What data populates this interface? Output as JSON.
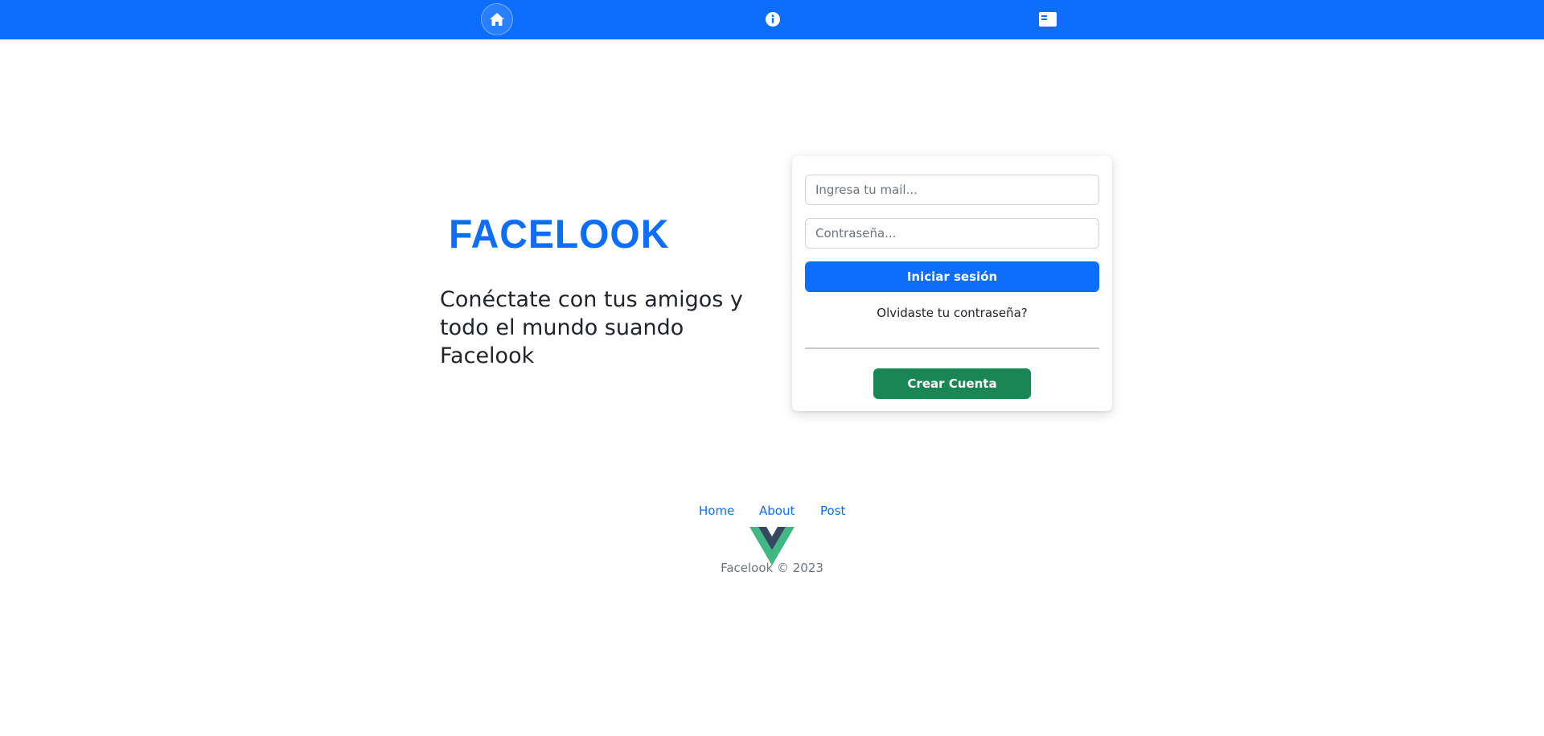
{
  "navbar": {
    "items": [
      {
        "label": "Home",
        "icon": "home-icon",
        "active": true
      },
      {
        "label": "About",
        "icon": "info-icon",
        "active": false
      },
      {
        "label": "Post",
        "icon": "post-card-icon",
        "active": false
      }
    ],
    "background_color": "#0d6efd"
  },
  "hero": {
    "brand": "FACELOOK",
    "tagline": "Conéctate con tus amigos y todo el mundo suando Facelook",
    "brand_color": "#0d6efd"
  },
  "login": {
    "email_placeholder": "Ingresa tu mail...",
    "email_value": "",
    "password_placeholder": "Contraseña...",
    "password_value": "",
    "login_button": "Iniciar sesión",
    "forgot_link": "Olvidaste tu contraseña?",
    "create_button": "Crear Cuenta",
    "login_color": "#0d6efd",
    "create_color": "#198754"
  },
  "footer": {
    "links": [
      "Home",
      "About",
      "Post"
    ],
    "logo_icon": "vue-logo-icon",
    "copyright": "Facelook © 2023"
  }
}
